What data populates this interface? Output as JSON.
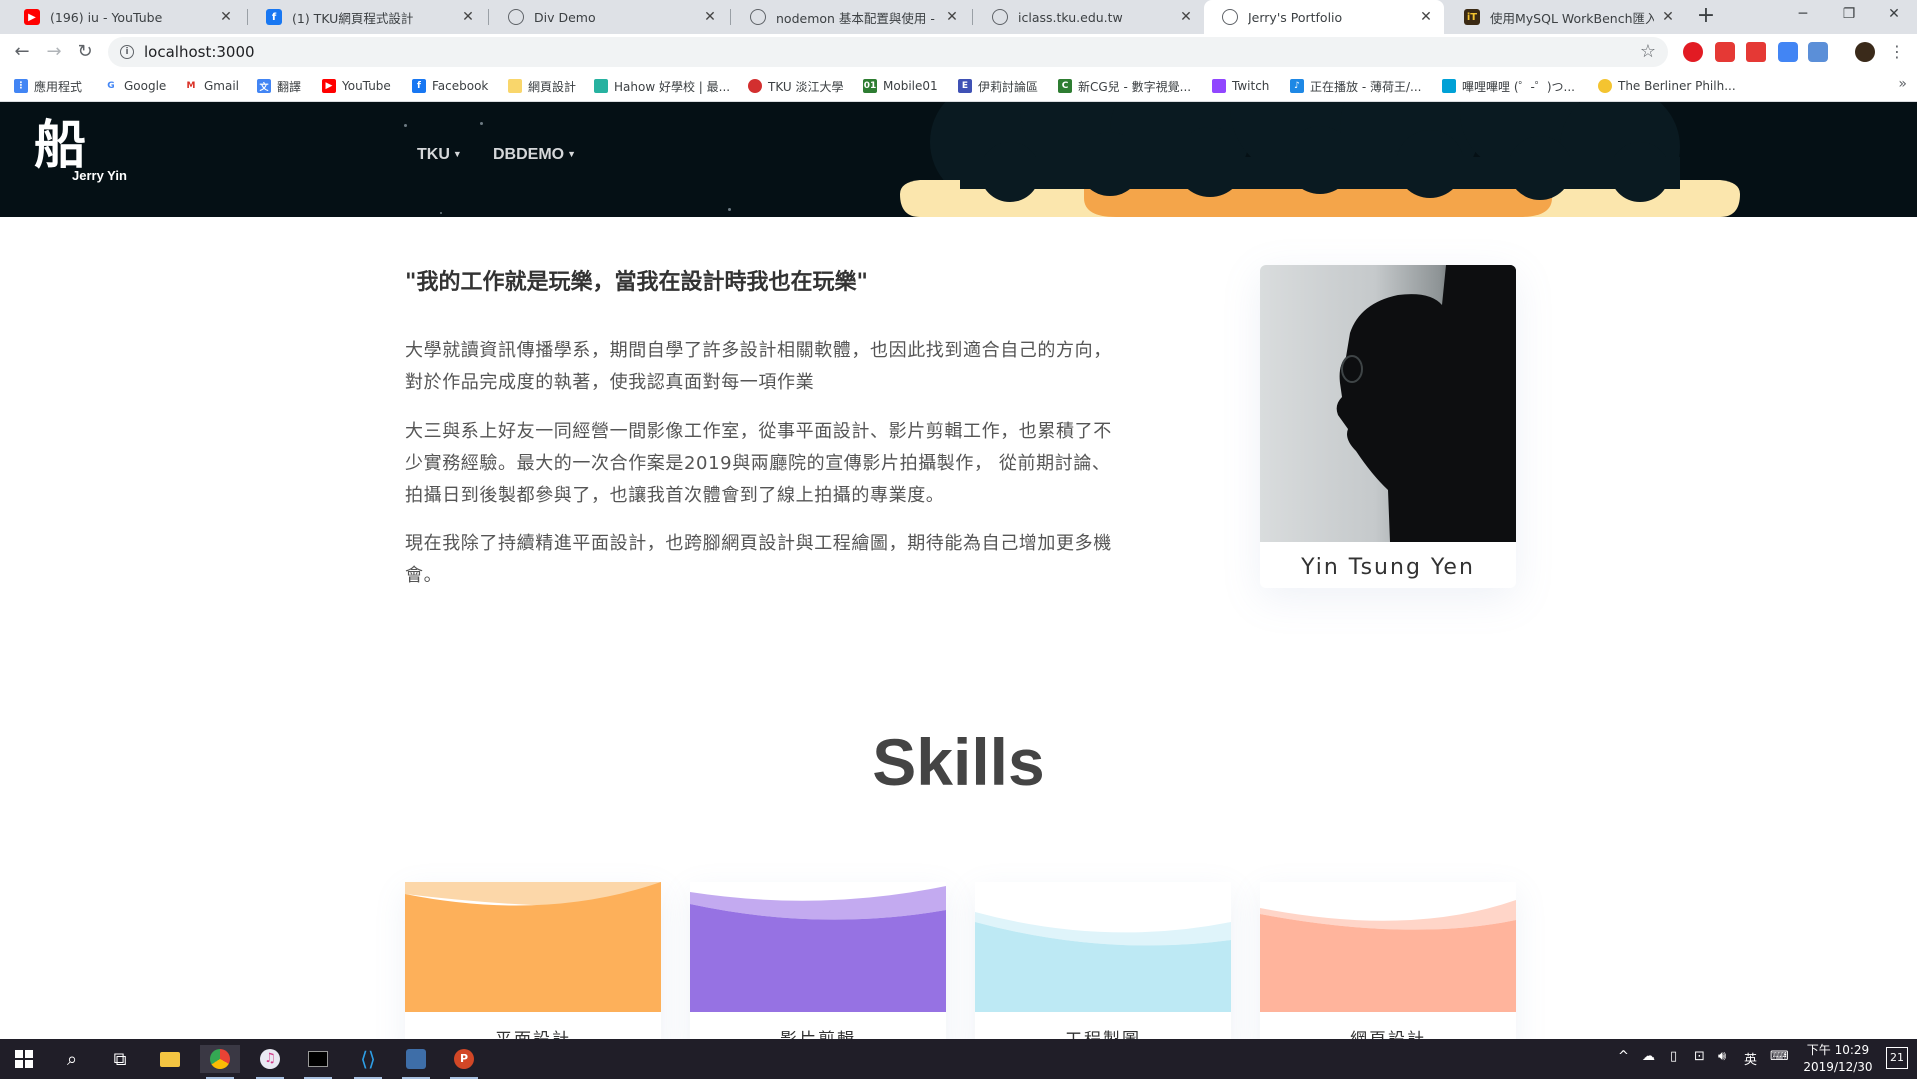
{
  "browser": {
    "tabs": [
      {
        "title": "(196) iu - YouTube",
        "icon": "youtube-icon",
        "color": "#ff0000"
      },
      {
        "title": "(1) TKU網頁程式設計",
        "icon": "facebook-icon",
        "color": "#1877f2"
      },
      {
        "title": "Div Demo",
        "icon": "globe-icon",
        "color": "#5f6368"
      },
      {
        "title": "nodemon 基本配置與使用 - 臺...",
        "icon": "globe-icon",
        "color": "#5f6368"
      },
      {
        "title": "iclass.tku.edu.tw",
        "icon": "globe-icon",
        "color": "#5f6368"
      },
      {
        "title": "Jerry's Portfolio",
        "icon": "globe-icon",
        "color": "#5f6368"
      },
      {
        "title": "使用MySQL WorkBench匯入資...",
        "icon": "ithome-icon",
        "color": "#3b2a14"
      }
    ],
    "active_tab_index": 5,
    "url": "localhost:3000",
    "bookmarks": [
      {
        "label": "應用程式",
        "icon": "apps-grid-icon",
        "color": "#4285f4"
      },
      {
        "label": "Google",
        "icon": "google-icon",
        "color": "#4285f4"
      },
      {
        "label": "Gmail",
        "icon": "gmail-icon",
        "color": "#d93025"
      },
      {
        "label": "翻譯",
        "icon": "translate-icon",
        "color": "#4285f4"
      },
      {
        "label": "YouTube",
        "icon": "youtube-icon",
        "color": "#ff0000"
      },
      {
        "label": "Facebook",
        "icon": "facebook-icon",
        "color": "#1877f2"
      },
      {
        "label": "網頁設計",
        "icon": "folder-icon",
        "color": "#f9d66b"
      },
      {
        "label": "Hahow 好學校 | 最...",
        "icon": "hahow-icon",
        "color": "#27b2a0"
      },
      {
        "label": "TKU 淡江大學",
        "icon": "tku-icon",
        "color": "#d32f2f"
      },
      {
        "label": "Mobile01",
        "icon": "mobile01-icon",
        "color": "#2e7d32"
      },
      {
        "label": "伊莉討論區",
        "icon": "eyny-icon",
        "color": "#3f51b5"
      },
      {
        "label": "新CG兒 - 數字視覺...",
        "icon": "cgjoy-icon",
        "color": "#2e7d32"
      },
      {
        "label": "Twitch",
        "icon": "twitch-icon",
        "color": "#9146ff"
      },
      {
        "label": "正在播放 - 薄荷王/...",
        "icon": "music-icon",
        "color": "#1e88e5"
      },
      {
        "label": "嗶哩嗶哩 (゜-゜)つ...",
        "icon": "bilibili-icon",
        "color": "#00a1d6"
      },
      {
        "label": "The Berliner Philh...",
        "icon": "berliner-icon",
        "color": "#f4c430"
      }
    ]
  },
  "site": {
    "logo_name": "Jerry Yin",
    "nav": [
      {
        "label": "TKU"
      },
      {
        "label": "DBDEMO"
      }
    ],
    "quote": "\"我的工作就是玩樂，當我在設計時我也在玩樂\"",
    "paragraphs": [
      "大學就讀資訊傳播學系，期間自學了許多設計相關軟體，也因此找到適合自己的方向，對於作品完成度的執著，使我認真面對每一項作業",
      "大三與系上好友一同經營一間影像工作室，從事平面設計、影片剪輯工作，也累積了不少實務經驗。最大的一次合作案是2019與兩廳院的宣傳影片拍攝製作， 從前期討論、拍攝日到後製都參與了，也讓我首次體會到了線上拍攝的專業度。",
      "現在我除了持續精進平面設計，也跨腳網頁設計與工程繪圖，期待能為自己增加更多機會。"
    ],
    "profile_name": "Yin Tsung Yen",
    "skills_title": "Skills",
    "skills": [
      {
        "label": "平面設計",
        "color": "#fdb05a",
        "wave_color": "#fcd7a9"
      },
      {
        "label": "影片剪輯",
        "color": "#9672e3",
        "wave_color": "#c3aaf0"
      },
      {
        "label": "工程製圖",
        "color": "#bde9f4",
        "wave_color": "#dff4fa"
      },
      {
        "label": "網頁設計",
        "color": "#ffb49c",
        "wave_color": "#ffd5c8"
      }
    ]
  },
  "taskbar": {
    "clock_time": "下午 10:29",
    "clock_date": "2019/12/30",
    "ime": "英",
    "notification_count": "21"
  }
}
